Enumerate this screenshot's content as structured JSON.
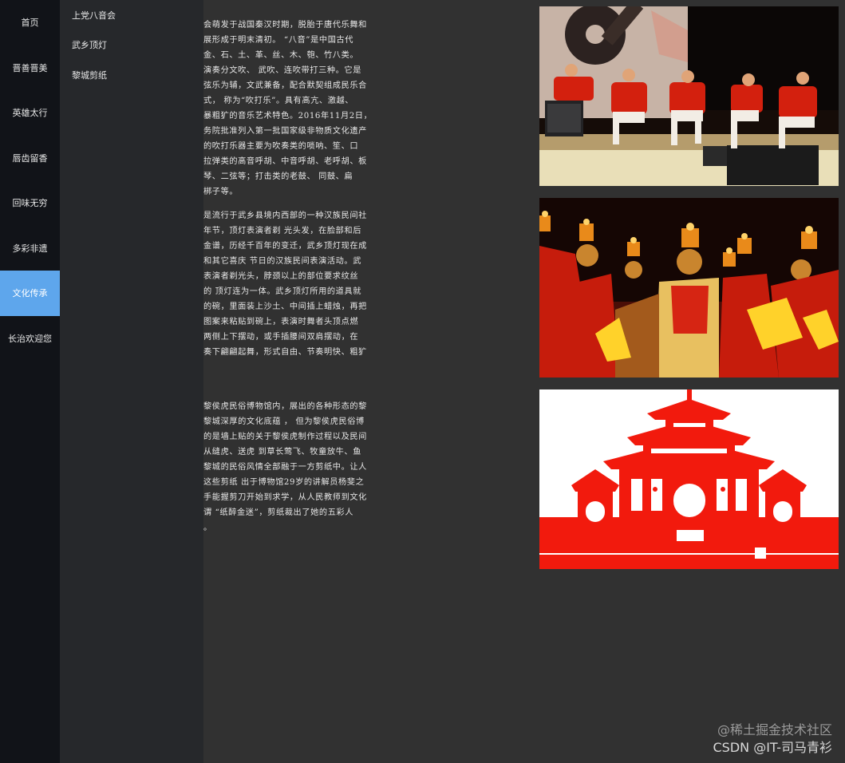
{
  "sidebar": {
    "items": [
      {
        "label": "首页"
      },
      {
        "label": "晋善晋美"
      },
      {
        "label": "英雄太行"
      },
      {
        "label": "唇齿留香"
      },
      {
        "label": "回味无穷"
      },
      {
        "label": "多彩非遗"
      },
      {
        "label": "文化传承"
      },
      {
        "label": "长治欢迎您"
      }
    ],
    "active_index": 6,
    "active_color": "#5ea6ec"
  },
  "subnav": {
    "items": [
      {
        "label": "上党八音会"
      },
      {
        "label": "武乡顶灯"
      },
      {
        "label": "黎城剪纸"
      }
    ]
  },
  "content": {
    "sections": [
      {
        "lines": [
          "会萌发于战国秦汉时期，脱胎于唐代乐舞和",
          "展形成于明末清初。 “八音”是中国古代",
          " 金、石、土、革、丝、木、匏、竹八类。",
          "演奏分文吹、 武吹、连吹带打三种。它是",
          "弦乐为辅，文武兼备，配合默契组成民乐合",
          "式， 称为“吹打乐”。具有高亢、激越、",
          "暴粗犷的音乐艺术特色。2016年11月2日，",
          "务院批准列入第一批国家级非物质文化遗产",
          "的吹打乐器主要为吹奏类的唢呐、笙、口",
          "拉弹类的高音呼胡、中音呼胡、老呼胡、板",
          "琴、二弦等；打击类的老鼓、 同鼓、扁",
          " 梆子等。"
        ]
      },
      {
        "lines": [
          "是流行于武乡县境内西部的一种汉族民间社",
          "年节，顶灯表演者剃 光头发，在脸部和后",
          "金谱，历经千百年的变迁，武乡顶灯现在成",
          "和其它喜庆 节日的汉族民间表演活动。武",
          " 表演者剃光头，脖颈以上的部位要求纹丝",
          "的 顶灯连为一体。武乡顶灯所用的道具就",
          "的碗，里面装上沙土、中间插上蜡烛，再把",
          " 图案来粘贴到碗上，表演时舞者头顶点燃",
          "两侧上下摆动，或手插腰间双肩摆动，在",
          "奏下翩翩起舞，形式自由、节奏明快、粗犷"
        ]
      },
      {
        "lines": [
          "黎侯虎民俗博物馆内，展出的各种形态的黎",
          "黎城深厚的文化底蕴 ， 但为黎侯虎民俗博",
          "的是墙上贴的关于黎侯虎制作过程以及民间",
          "从缝虎、送虎 到草长莺飞、牧童放牛、鱼",
          "黎城的民俗风情全部融于一方剪纸中。让人",
          "这些剪纸 出于博物馆29岁的讲解员杨斐之",
          "手能握剪刀开始到求学，从人民教师到文化",
          "谓 “纸醉金迷”，剪纸裁出了她的五彩人",
          "。"
        ]
      }
    ]
  },
  "images": [
    {
      "subject": "八音会乐队演奏"
    },
    {
      "subject": "武乡顶灯表演"
    },
    {
      "subject": "黎城剪纸楼阁"
    }
  ],
  "watermark": {
    "line1": "@稀土掘金技术社区",
    "line2": "CSDN @IT-司马青衫"
  },
  "colors": {
    "page_bg": "#313131",
    "sidebar_bg": "#111318",
    "subnav_bg": "#26282b",
    "papercut_red": "#f21a0d"
  }
}
